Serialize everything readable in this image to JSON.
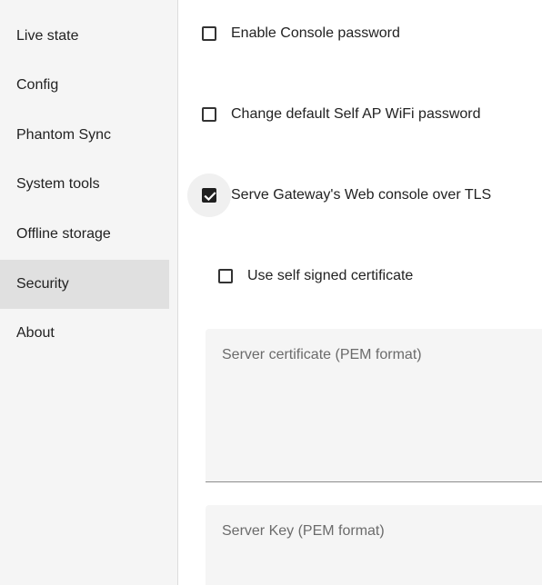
{
  "sidebar": {
    "items": [
      {
        "label": "Live state"
      },
      {
        "label": "Config"
      },
      {
        "label": "Phantom Sync"
      },
      {
        "label": "System tools"
      },
      {
        "label": "Offline storage"
      },
      {
        "label": "Security",
        "active": true
      },
      {
        "label": "About"
      }
    ]
  },
  "security": {
    "enable_console_password": {
      "label": "Enable Console password",
      "checked": false
    },
    "change_ap_password": {
      "label": "Change default Self AP WiFi password",
      "checked": false
    },
    "serve_tls": {
      "label": "Serve Gateway's Web console over TLS",
      "checked": true
    },
    "self_signed": {
      "label": "Use self signed certificate",
      "checked": false
    },
    "server_certificate": {
      "placeholder": "Server certificate (PEM format)"
    },
    "server_key": {
      "placeholder": "Server Key (PEM format)"
    }
  },
  "colors": {
    "sidebar_bg": "#f5f5f5",
    "active_item_bg": "#e0e0e0",
    "checkbox_checked": "#1f1f1f",
    "field_bg": "#f5f5f5",
    "placeholder_text": "#6b6b6b"
  }
}
